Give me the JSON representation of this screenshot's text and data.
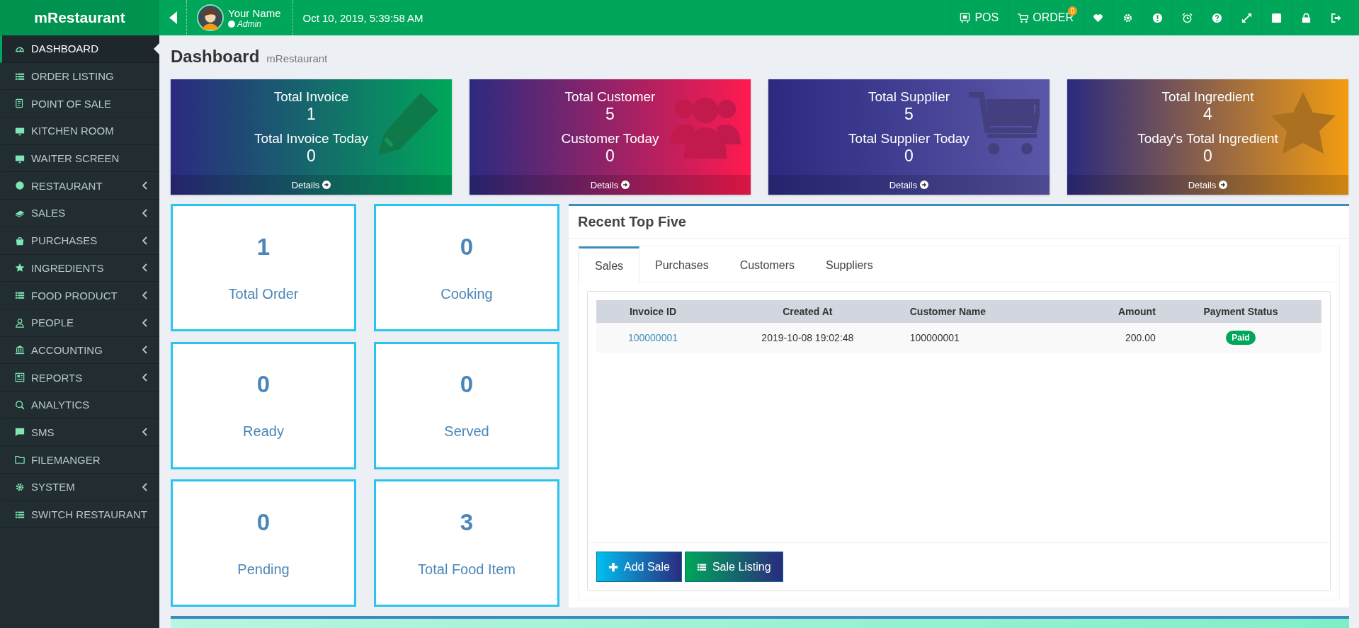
{
  "app": {
    "brand": "mRestaurant"
  },
  "topbar": {
    "user": {
      "name": "Your Name",
      "role": "Admin"
    },
    "datetime": "Oct 10, 2019, 5:39:58 AM",
    "actions": [
      {
        "kind": "pos",
        "label": "POS"
      },
      {
        "kind": "cart",
        "label": "ORDER",
        "badge": "0"
      },
      {
        "kind": "heart"
      },
      {
        "kind": "gear"
      },
      {
        "kind": "alert"
      },
      {
        "kind": "alarm"
      },
      {
        "kind": "help"
      },
      {
        "kind": "expand"
      },
      {
        "kind": "square"
      },
      {
        "kind": "lock"
      },
      {
        "kind": "logout"
      }
    ]
  },
  "sidebar": {
    "items": [
      {
        "kind": "gauge",
        "label": "DASHBOARD",
        "selected": true,
        "submenu": false
      },
      {
        "kind": "list",
        "label": "ORDER LISTING",
        "selected": false,
        "submenu": false
      },
      {
        "kind": "form",
        "label": "POINT OF SALE",
        "selected": false,
        "submenu": false
      },
      {
        "kind": "monitor",
        "label": "KITCHEN ROOM",
        "selected": false,
        "submenu": false
      },
      {
        "kind": "monitor",
        "label": "WAITER SCREEN",
        "selected": false,
        "submenu": false
      },
      {
        "kind": "plate",
        "label": "RESTAURANT",
        "selected": false,
        "submenu": true
      },
      {
        "kind": "money",
        "label": "SALES",
        "selected": false,
        "submenu": true
      },
      {
        "kind": "bag",
        "label": "PURCHASES",
        "selected": false,
        "submenu": true
      },
      {
        "kind": "star",
        "label": "INGREDIENTS",
        "selected": false,
        "submenu": true
      },
      {
        "kind": "list",
        "label": "FOOD PRODUCT",
        "selected": false,
        "submenu": true
      },
      {
        "kind": "user",
        "label": "PEOPLE",
        "selected": false,
        "submenu": true
      },
      {
        "kind": "bank",
        "label": "ACCOUNTING",
        "selected": false,
        "submenu": true
      },
      {
        "kind": "report",
        "label": "REPORTS",
        "selected": false,
        "submenu": true
      },
      {
        "kind": "search",
        "label": "ANALYTICS",
        "selected": false,
        "submenu": false
      },
      {
        "kind": "chat",
        "label": "SMS",
        "selected": false,
        "submenu": true
      },
      {
        "kind": "folder",
        "label": "FILEMANGER",
        "selected": false,
        "submenu": false
      },
      {
        "kind": "gear",
        "label": "SYSTEM",
        "selected": false,
        "submenu": true
      },
      {
        "kind": "list",
        "label": "SWITCH RESTAURANT",
        "selected": false,
        "submenu": false
      }
    ]
  },
  "page_header": {
    "title": "Dashboard",
    "subtitle": "mRestaurant"
  },
  "stat_cards": [
    {
      "kind": "invoice",
      "label": "Total Invoice",
      "value": "1",
      "today_label": "Total Invoice Today",
      "today_value": "0",
      "link": "Details"
    },
    {
      "kind": "customer",
      "label": "Total Customer",
      "value": "5",
      "today_label": "Customer Today",
      "today_value": "0",
      "link": "Details"
    },
    {
      "kind": "supplier",
      "label": "Total Supplier",
      "value": "5",
      "today_label": "Total Supplier Today",
      "today_value": "0",
      "link": "Details"
    },
    {
      "kind": "ingredient",
      "label": "Total Ingredient",
      "value": "4",
      "today_label": "Today's Total Ingredient",
      "today_value": "0",
      "link": "Details"
    }
  ],
  "order_boxes": [
    {
      "value": "1",
      "label": "Total Order"
    },
    {
      "value": "0",
      "label": "Cooking"
    },
    {
      "value": "0",
      "label": "Ready"
    },
    {
      "value": "0",
      "label": "Served"
    },
    {
      "value": "0",
      "label": "Pending"
    },
    {
      "value": "3",
      "label": "Total Food Item"
    }
  ],
  "recent_panel": {
    "title": "Recent Top Five",
    "tabs": [
      {
        "label": "Sales",
        "selected": true
      },
      {
        "label": "Purchases",
        "selected": false
      },
      {
        "label": "Customers",
        "selected": false
      },
      {
        "label": "Suppliers",
        "selected": false
      }
    ],
    "table": {
      "columns": [
        "Invoice ID",
        "Created At",
        "Customer Name",
        "Amount",
        "Payment Status"
      ],
      "rows": [
        {
          "invoice_id": "100000001",
          "created_at": "2019-10-08 19:02:48",
          "customer_name": "100000001",
          "amount": "200.00",
          "payment_status": "Paid"
        }
      ]
    },
    "buttons": [
      {
        "kind": "add",
        "label": "Add Sale"
      },
      {
        "kind": "list",
        "label": "Sale Listing"
      }
    ]
  }
}
